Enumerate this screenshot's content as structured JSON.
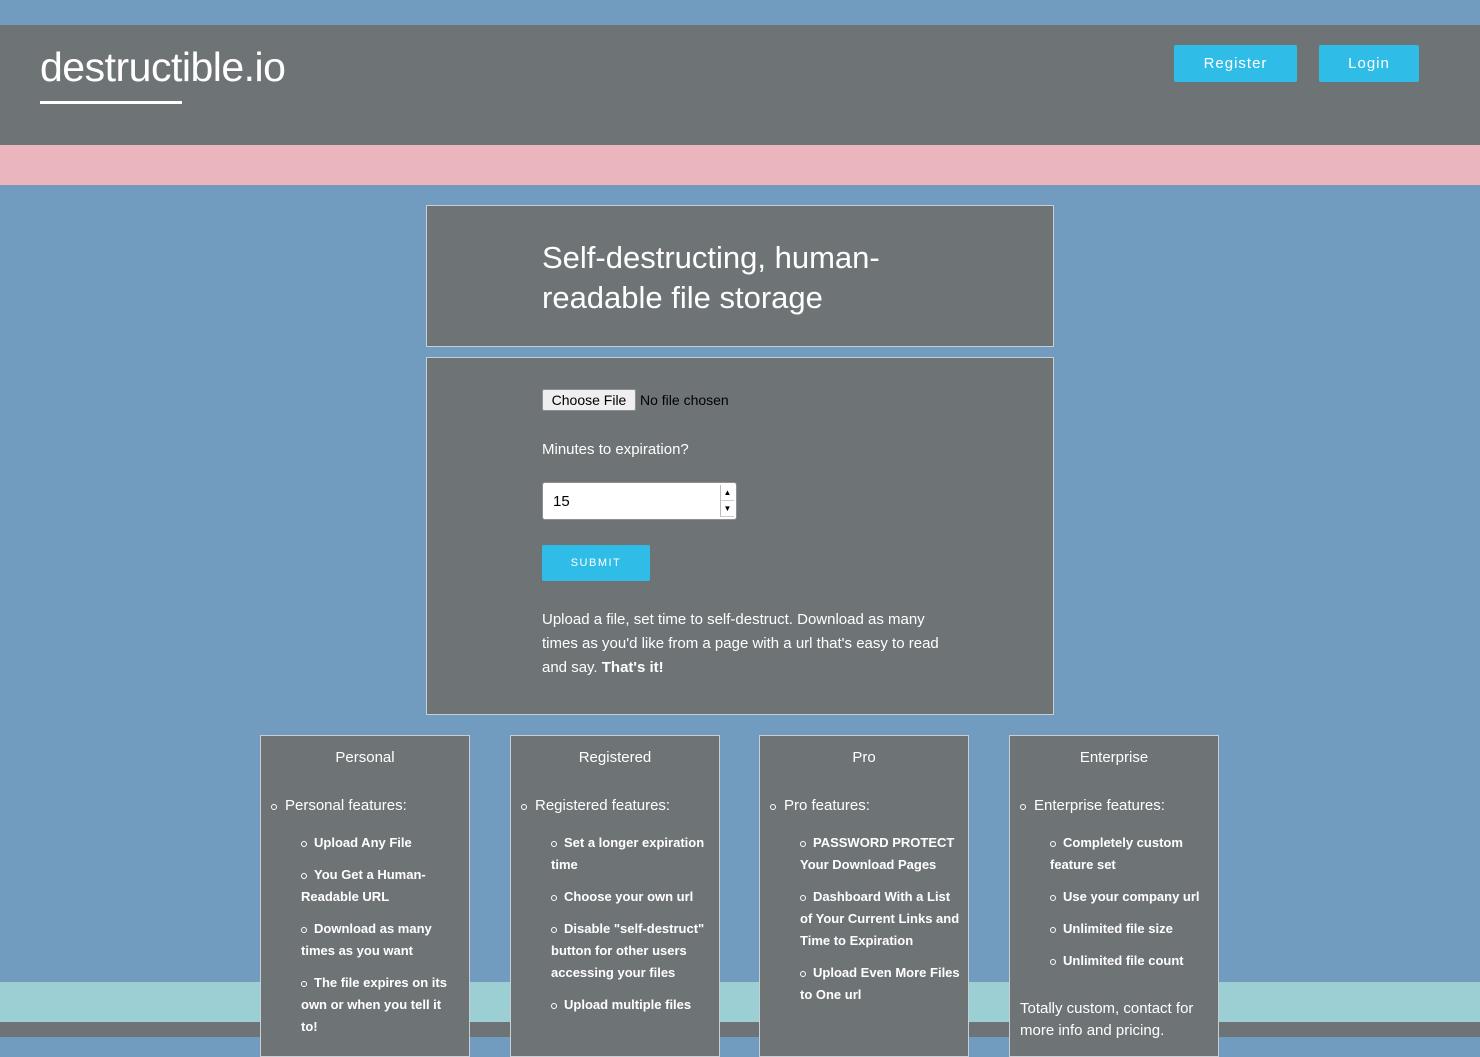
{
  "header": {
    "logo": "destructible.io",
    "register_label": "Register",
    "login_label": "Login"
  },
  "hero": {
    "headline": "Self-destructing, human-readable file storage"
  },
  "upload_form": {
    "choose_file_label": "Choose File",
    "file_status": "No file chosen",
    "expiration_label": "Minutes to expiration?",
    "expiration_value": "15",
    "submit_label": "SUBMIT",
    "description": "Upload a file, set time to self-destruct. Download as many times as you'd like from a page with a url that's easy to read and say.",
    "description_emphasis": "That's it!"
  },
  "tiers": [
    {
      "name": "Personal",
      "features_heading": "Personal features:",
      "features": [
        "Upload Any File",
        "You Get a Human-Readable URL",
        "Download as many times as you want",
        "The file expires on its own or when you tell it to!"
      ]
    },
    {
      "name": "Registered",
      "features_heading": "Registered features:",
      "features": [
        "Set a longer expiration time",
        "Choose your own url",
        "Disable \"self-destruct\" button for other users accessing your files",
        "Upload multiple files"
      ]
    },
    {
      "name": "Pro",
      "features_heading": "Pro features:",
      "features": [
        "PASSWORD PROTECT Your Download Pages",
        "Dashboard With a List of Your Current Links and Time to Expiration",
        "Upload Even More Files to One url"
      ]
    },
    {
      "name": "Enterprise",
      "features_heading": "Enterprise features:",
      "features": [
        "Completely custom feature set",
        "Use your company url",
        "Unlimited file size",
        "Unlimited file count"
      ],
      "note": "Totally custom, contact for more info and pricing."
    }
  ],
  "colors": {
    "background_blue": "#719cc0",
    "panel_gray": "#6e7476",
    "band_pink": "#ebb5bd",
    "band_teal": "#9bcfd3",
    "accent_button": "#2fbde8"
  }
}
